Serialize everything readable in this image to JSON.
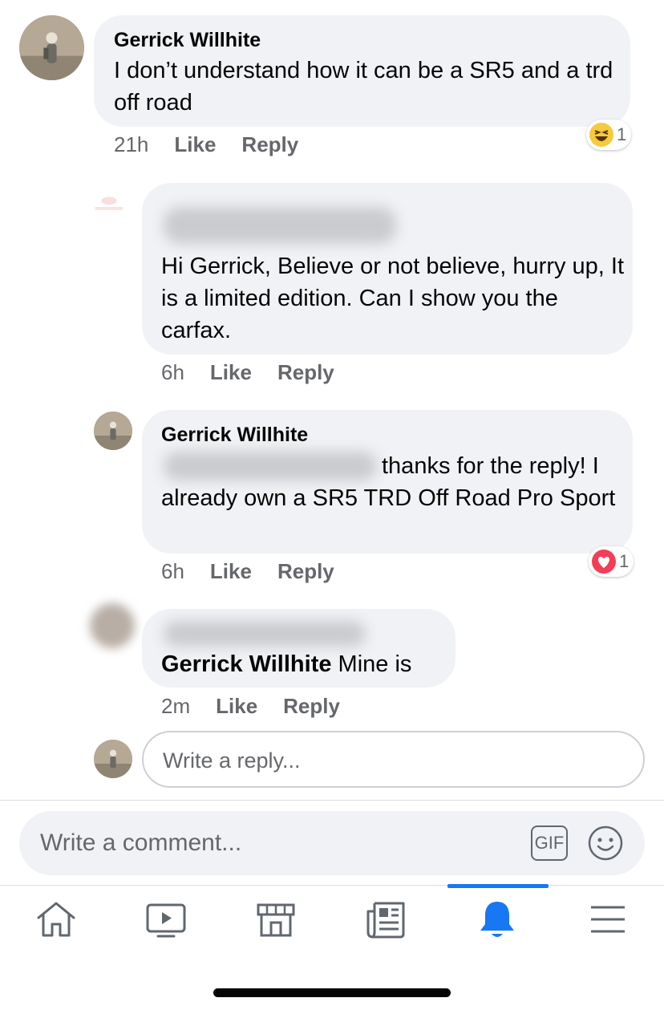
{
  "comments": [
    {
      "author": "Gerrick Willhite",
      "text": "I don’t understand how it can be a SR5 and a trd off road",
      "time": "21h",
      "like": "Like",
      "reply": "Reply",
      "reaction": {
        "icon": "haha-reaction-icon",
        "count": "1"
      }
    },
    {
      "author": "",
      "text": "Hi Gerrick, Believe or not believe, hurry up, It is a limited edition.  Can I show you the carfax.",
      "time": "6h",
      "like": "Like",
      "reply": "Reply"
    },
    {
      "author": "Gerrick Willhite",
      "text": "thanks for the reply! I already own a SR5 TRD Off Road Pro Sport",
      "time": "6h",
      "like": "Like",
      "reply": "Reply",
      "reaction": {
        "icon": "love-reaction-icon",
        "count": "1"
      }
    },
    {
      "author": "",
      "mention": "Gerrick Willhite",
      "text": " Mine is",
      "time": "2m",
      "like": "Like",
      "reply": "Reply"
    }
  ],
  "reply_input": {
    "placeholder": "Write a reply..."
  },
  "comment_input": {
    "placeholder": "Write a comment...",
    "gif_label": "GIF",
    "emoji_icon": "smiley-icon"
  },
  "bottom_nav": {
    "items": [
      "home-icon",
      "watch-icon",
      "marketplace-icon",
      "news-icon",
      "notifications-icon",
      "menu-icon"
    ],
    "active": "notifications-icon",
    "active_color": "#1877f2"
  }
}
